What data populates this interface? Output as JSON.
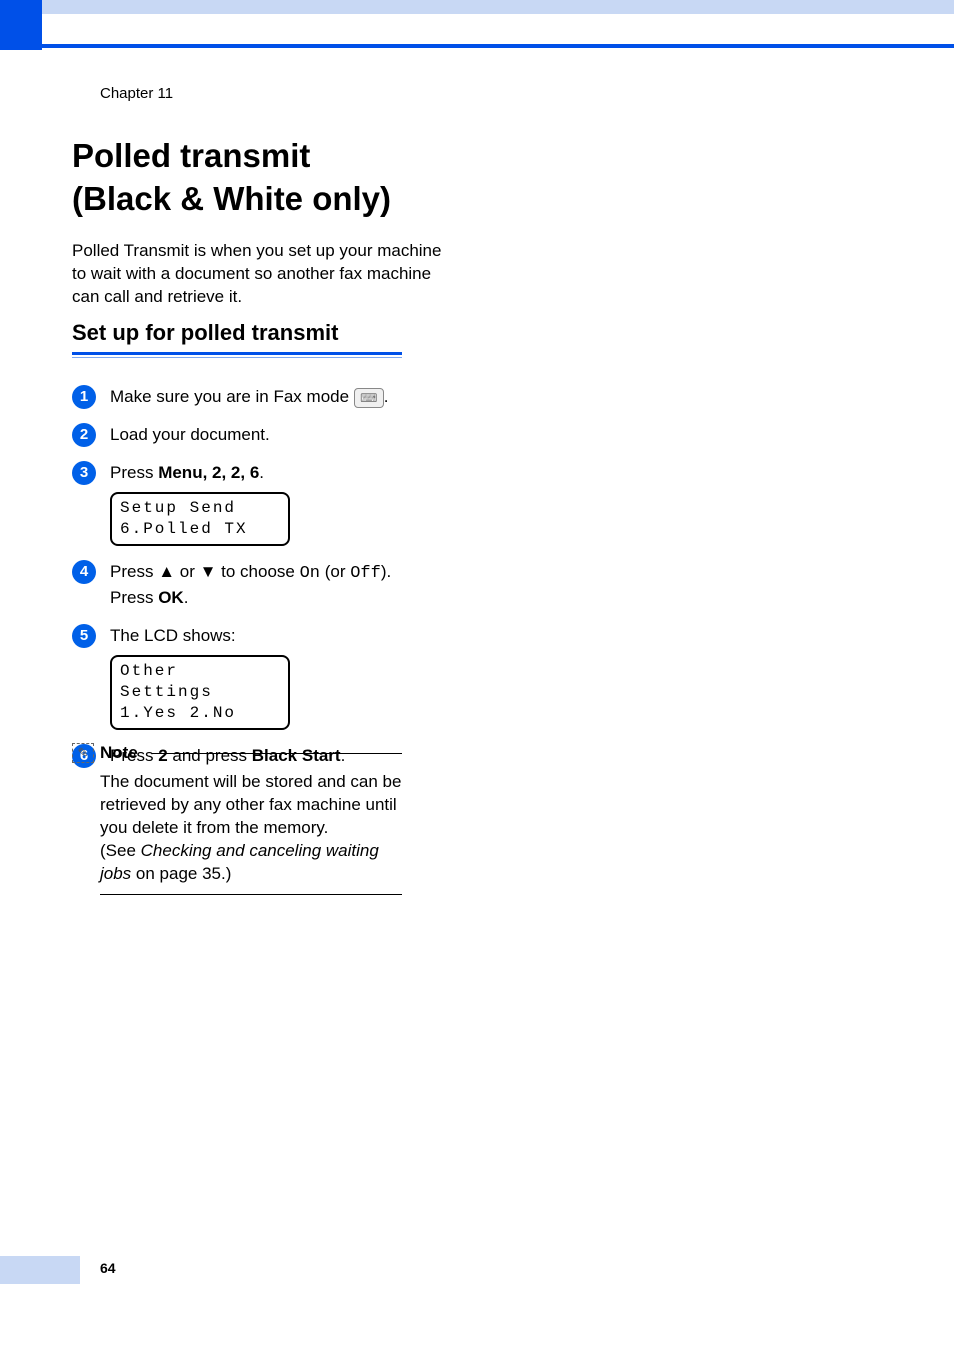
{
  "chapter": "Chapter 11",
  "title_line1": "Polled transmit",
  "title_line2": "(Black & White only)",
  "intro": "Polled Transmit is when you set up your machine to wait with a document so another fax machine can call and retrieve it.",
  "subsection": "Set up for polled transmit",
  "steps": {
    "s1": {
      "num": "1",
      "text": "Make sure you are in Fax mode "
    },
    "s2": {
      "num": "2",
      "text": "Load your document."
    },
    "s3": {
      "num": "3",
      "press": "Press ",
      "menu": "Menu",
      "keys": ", 2, 2, 6",
      "lcd_line1": "Setup Send",
      "lcd_line2": "6.Polled TX"
    },
    "s4": {
      "num": "4",
      "press": "Press ",
      "up": "▲",
      "or": " or ",
      "down": "▼",
      "choose": " to choose ",
      "on": "On",
      "paren": " (or ",
      "off": "Off",
      "close": ").",
      "press_ok_1": "Press ",
      "ok": "OK",
      "dot": "."
    },
    "s5": {
      "num": "5",
      "text": "The LCD shows:",
      "lcd_line1": "Other Settings",
      "lcd_line2": "1.Yes 2.No"
    },
    "s6": {
      "num": "6",
      "press": "Press ",
      "two": "2",
      "and": " and press ",
      "black_start": "Black Start",
      "dot": "."
    }
  },
  "note": {
    "label": "Note",
    "body": "The document will be stored and can be retrieved by any other fax machine until you delete it from the memory.",
    "see": "(See ",
    "cross_ref": "Checking and canceling waiting jobs",
    "on_page": " on page 35.)"
  },
  "page_number": "64"
}
